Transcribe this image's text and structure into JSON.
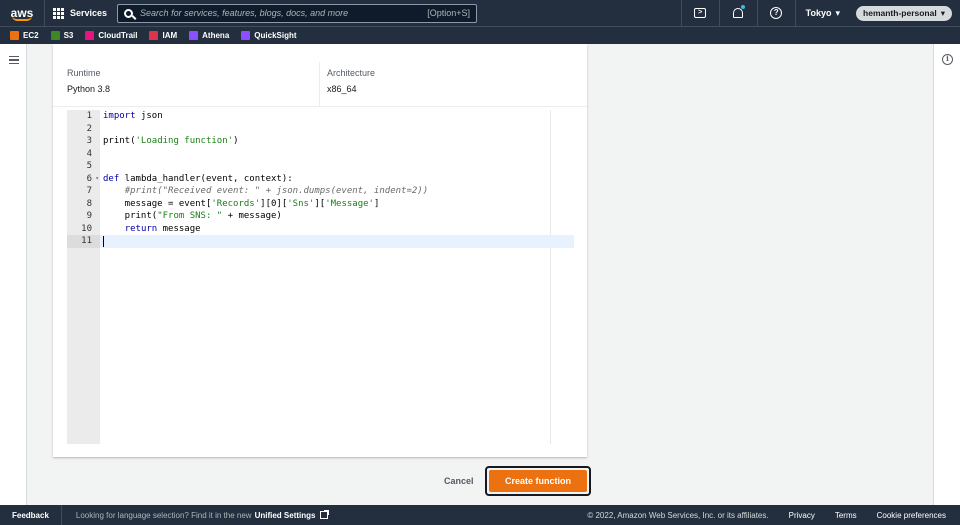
{
  "topnav": {
    "logo": "aws",
    "services_label": "Services",
    "search_placeholder": "Search for services, features, blogs, docs, and more",
    "search_shortcut": "[Option+S]",
    "region_label": "Tokyo",
    "account_label": "hemanth-personal"
  },
  "favorites": [
    {
      "label": "EC2",
      "color": "#ec7211"
    },
    {
      "label": "S3",
      "color": "#3f8624"
    },
    {
      "label": "CloudTrail",
      "color": "#e7157b"
    },
    {
      "label": "IAM",
      "color": "#dd344c"
    },
    {
      "label": "Athena",
      "color": "#8c4fff"
    },
    {
      "label": "QuickSight",
      "color": "#8c4fff"
    }
  ],
  "config": {
    "runtime_label": "Runtime",
    "runtime_value": "Python 3.8",
    "architecture_label": "Architecture",
    "architecture_value": "x86_64"
  },
  "editor": {
    "line_numbers": [
      "1",
      "2",
      "3",
      "4",
      "5",
      "6",
      "7",
      "8",
      "9",
      "10",
      "11"
    ],
    "active_line": 11
  },
  "actions": {
    "cancel_label": "Cancel",
    "create_label": "Create function"
  },
  "footer": {
    "feedback_label": "Feedback",
    "language_msg": "Looking for language selection? Find it in the new",
    "unified_settings_label": "Unified Settings",
    "copyright": "© 2022, Amazon Web Services, Inc. or its affiliates.",
    "privacy_label": "Privacy",
    "terms_label": "Terms",
    "cookie_label": "Cookie preferences"
  },
  "colors": {
    "nav_bg": "#232f3e",
    "primary_button": "#ec7211"
  }
}
